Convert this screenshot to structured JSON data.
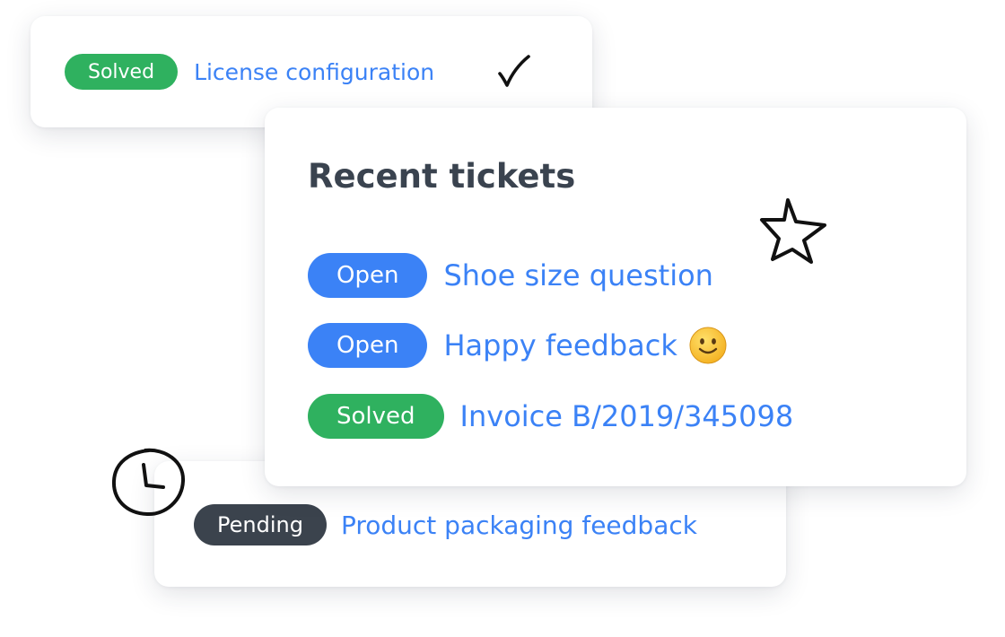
{
  "tickets_top": {
    "status": "Solved",
    "title": "License configuration"
  },
  "recent": {
    "heading": "Recent tickets",
    "items": [
      {
        "status": "Open",
        "title": "Shoe size question"
      },
      {
        "status": "Open",
        "title": "Happy feedback"
      },
      {
        "status": "Solved",
        "title": "Invoice B/2019/345098"
      }
    ]
  },
  "tickets_bottom": {
    "status": "Pending",
    "title": "Product packaging feedback"
  },
  "icons": {
    "top_mark": "checkmark-icon",
    "decor_star": "star-doodle-icon",
    "decor_clock": "clock-doodle-icon",
    "emoji": "slightly-smiling-face-icon"
  },
  "colors": {
    "open": "#3b82f6",
    "solved": "#2fb15f",
    "pending": "#3b434d",
    "link": "#3b82f6",
    "heading": "#3a434f"
  }
}
